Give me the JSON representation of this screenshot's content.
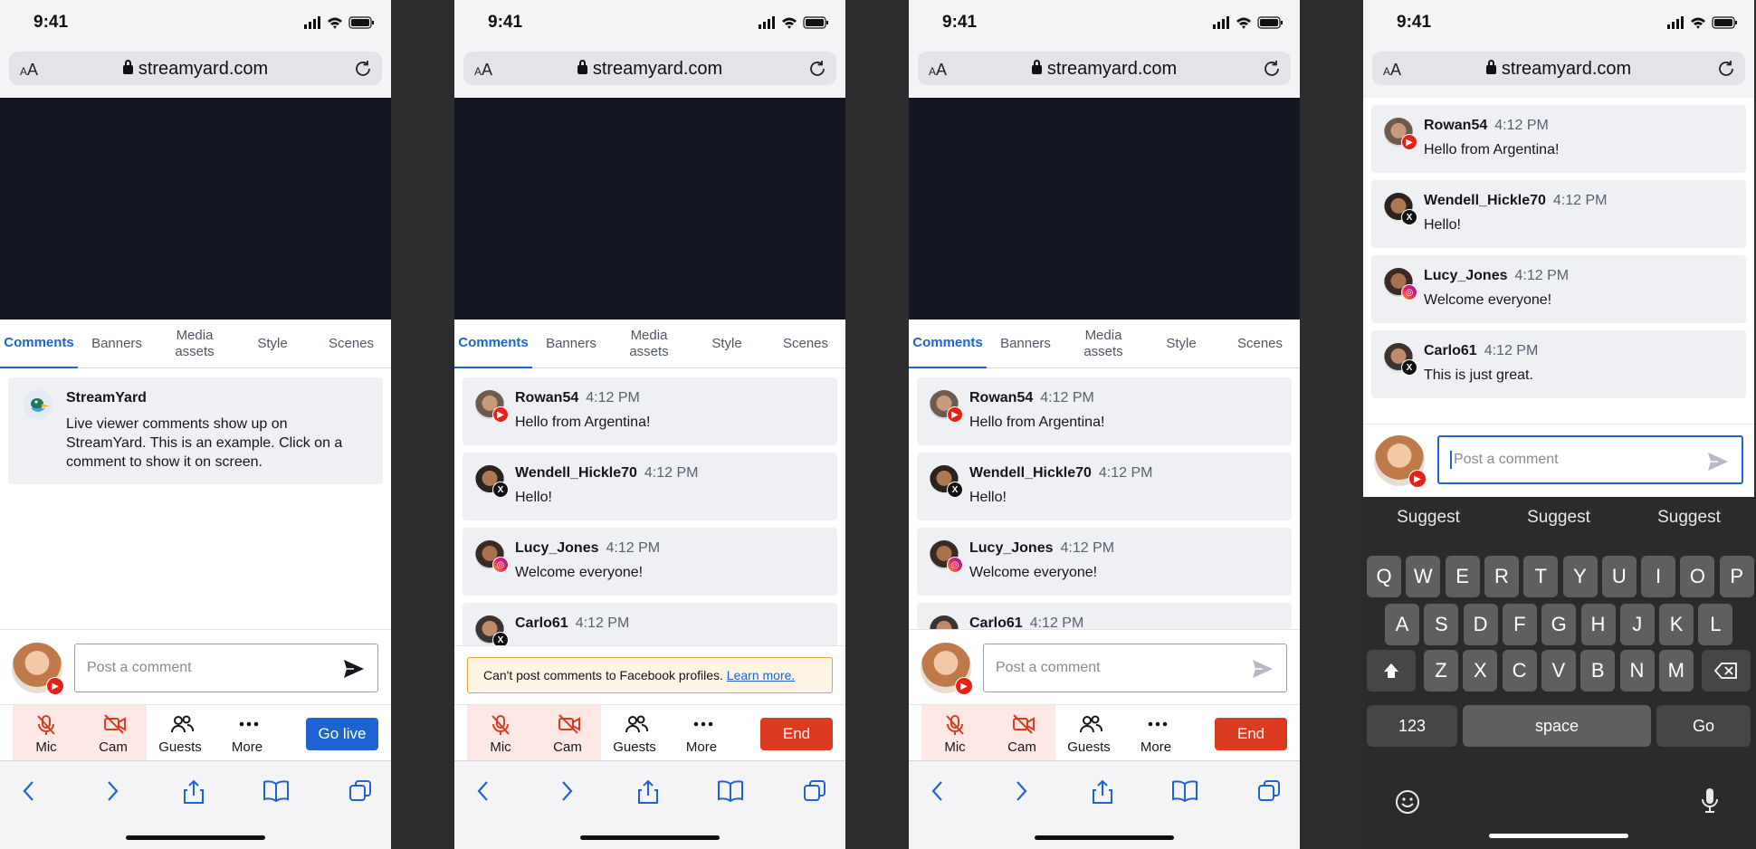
{
  "status": {
    "time": "9:41"
  },
  "browser": {
    "aa": "AA",
    "url": "streamyard.com"
  },
  "tabs": [
    "Comments",
    "Banners",
    "Media\nassets",
    "Style",
    "Scenes"
  ],
  "sample_comment": {
    "name": "StreamYard",
    "text": "Live viewer comments show up on StreamYard. This is an example. Click on a comment to show it on screen."
  },
  "comments": [
    {
      "name": "Rowan54",
      "time": "4:12 PM",
      "text": "Hello from Argentina!",
      "platform": "youtube"
    },
    {
      "name": "Wendell_Hickle70",
      "time": "4:12 PM",
      "text": "Hello!",
      "platform": "x"
    },
    {
      "name": "Lucy_Jones",
      "time": "4:12 PM",
      "text": "Welcome everyone!",
      "platform": "instagram"
    },
    {
      "name": "Carlo61",
      "time": "4:12 PM",
      "text": "This is just great.",
      "platform": "x"
    }
  ],
  "composer": {
    "placeholder": "Post a comment"
  },
  "warning": {
    "text": "Can't post comments to Facebook profiles.",
    "link": "Learn more."
  },
  "controls": {
    "mic": "Mic",
    "cam": "Cam",
    "guests": "Guests",
    "more": "More",
    "go_live": "Go live",
    "end": "End"
  },
  "keyboard": {
    "suggestions": [
      "Suggest",
      "Suggest",
      "Suggest"
    ],
    "row1": [
      "Q",
      "W",
      "E",
      "R",
      "T",
      "Y",
      "U",
      "I",
      "O",
      "P"
    ],
    "row2": [
      "A",
      "S",
      "D",
      "F",
      "G",
      "H",
      "J",
      "K",
      "L"
    ],
    "row3": [
      "Z",
      "X",
      "C",
      "V",
      "B",
      "N",
      "M"
    ],
    "numbers": "123",
    "space": "space",
    "go": "Go"
  },
  "colors": {
    "accent": "#1f63d3",
    "end": "#dc3b21",
    "youtube": "#e62117",
    "video_bg": "#131722"
  }
}
